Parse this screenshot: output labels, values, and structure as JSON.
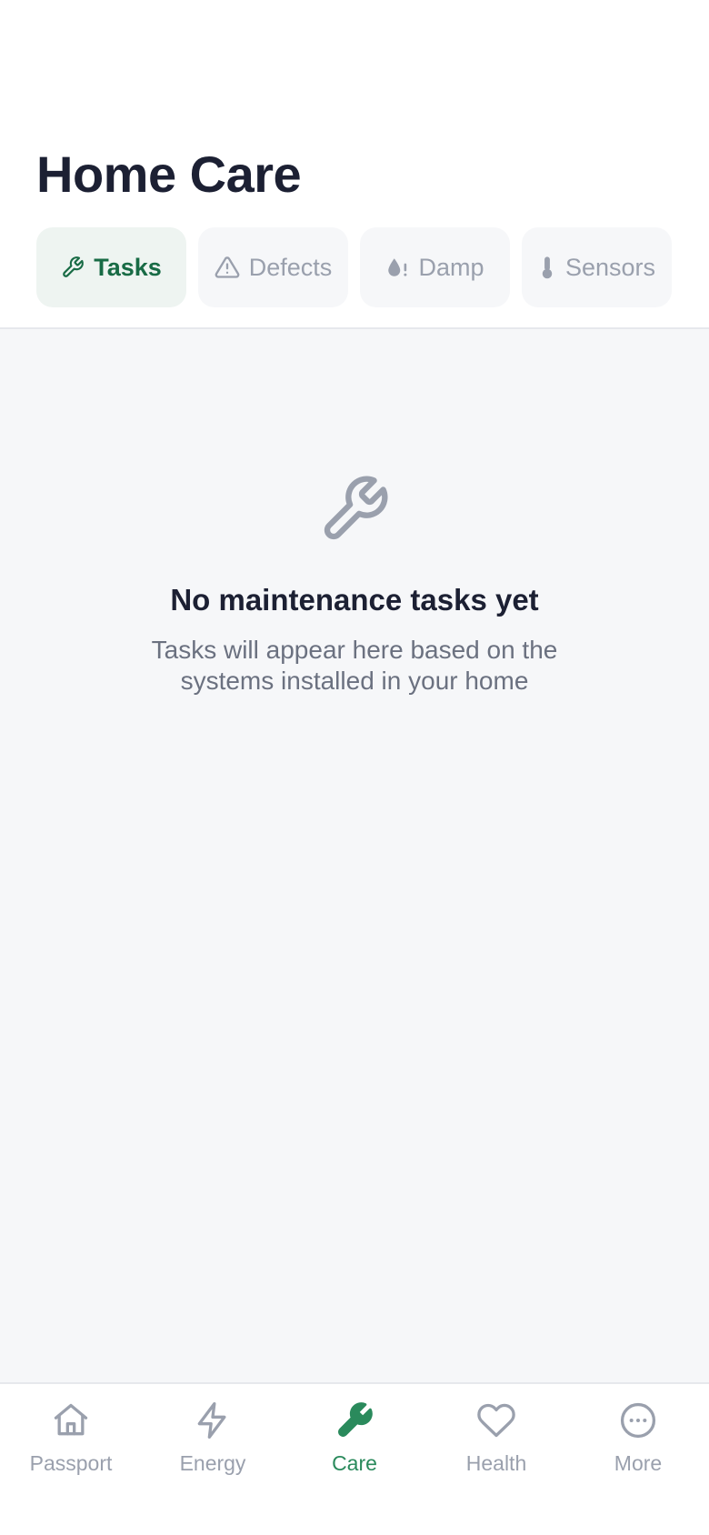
{
  "header": {
    "title": "Home Care"
  },
  "tabs": [
    {
      "label": "Tasks",
      "icon": "wrench-icon",
      "active": true
    },
    {
      "label": "Defects",
      "icon": "warning-triangle-icon",
      "active": false
    },
    {
      "label": "Damp",
      "icon": "water-drop-icon",
      "active": false
    },
    {
      "label": "Sensors",
      "icon": "thermometer-icon",
      "active": false
    }
  ],
  "empty_state": {
    "icon": "wrench-icon",
    "title": "No maintenance tasks yet",
    "description": "Tasks will appear here based on the systems installed in your home"
  },
  "bottom_nav": [
    {
      "label": "Passport",
      "icon": "home-icon",
      "active": false
    },
    {
      "label": "Energy",
      "icon": "lightning-icon",
      "active": false
    },
    {
      "label": "Care",
      "icon": "wrench-icon",
      "active": true
    },
    {
      "label": "Health",
      "icon": "heart-icon",
      "active": false
    },
    {
      "label": "More",
      "icon": "more-circle-icon",
      "active": false
    }
  ],
  "colors": {
    "accent": "#2a8a5c",
    "accent_dark": "#186b45",
    "muted": "#9aa0ad",
    "title": "#1c2033",
    "background": "#f6f7f9"
  }
}
